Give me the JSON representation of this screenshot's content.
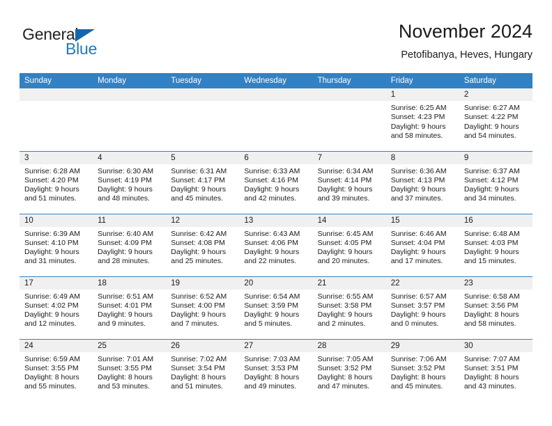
{
  "brand": {
    "name_part1": "General",
    "name_part2": "Blue",
    "triangle_color": "#1266b0",
    "blue_color": "#1f78c1"
  },
  "header": {
    "title": "November 2024",
    "subtitle": "Petofibanya, Heves, Hungary"
  },
  "theme": {
    "header_bg": "#3281c4",
    "daynum_bg": "#f0f0f0",
    "rule_color": "#3281c4"
  },
  "weekday_headers": [
    "Sunday",
    "Monday",
    "Tuesday",
    "Wednesday",
    "Thursday",
    "Friday",
    "Saturday"
  ],
  "weeks": [
    [
      {
        "day": "",
        "sunrise": "",
        "sunset": "",
        "daylight1": "",
        "daylight2": ""
      },
      {
        "day": "",
        "sunrise": "",
        "sunset": "",
        "daylight1": "",
        "daylight2": ""
      },
      {
        "day": "",
        "sunrise": "",
        "sunset": "",
        "daylight1": "",
        "daylight2": ""
      },
      {
        "day": "",
        "sunrise": "",
        "sunset": "",
        "daylight1": "",
        "daylight2": ""
      },
      {
        "day": "",
        "sunrise": "",
        "sunset": "",
        "daylight1": "",
        "daylight2": ""
      },
      {
        "day": "1",
        "sunrise": "Sunrise: 6:25 AM",
        "sunset": "Sunset: 4:23 PM",
        "daylight1": "Daylight: 9 hours",
        "daylight2": "and 58 minutes."
      },
      {
        "day": "2",
        "sunrise": "Sunrise: 6:27 AM",
        "sunset": "Sunset: 4:22 PM",
        "daylight1": "Daylight: 9 hours",
        "daylight2": "and 54 minutes."
      }
    ],
    [
      {
        "day": "3",
        "sunrise": "Sunrise: 6:28 AM",
        "sunset": "Sunset: 4:20 PM",
        "daylight1": "Daylight: 9 hours",
        "daylight2": "and 51 minutes."
      },
      {
        "day": "4",
        "sunrise": "Sunrise: 6:30 AM",
        "sunset": "Sunset: 4:19 PM",
        "daylight1": "Daylight: 9 hours",
        "daylight2": "and 48 minutes."
      },
      {
        "day": "5",
        "sunrise": "Sunrise: 6:31 AM",
        "sunset": "Sunset: 4:17 PM",
        "daylight1": "Daylight: 9 hours",
        "daylight2": "and 45 minutes."
      },
      {
        "day": "6",
        "sunrise": "Sunrise: 6:33 AM",
        "sunset": "Sunset: 4:16 PM",
        "daylight1": "Daylight: 9 hours",
        "daylight2": "and 42 minutes."
      },
      {
        "day": "7",
        "sunrise": "Sunrise: 6:34 AM",
        "sunset": "Sunset: 4:14 PM",
        "daylight1": "Daylight: 9 hours",
        "daylight2": "and 39 minutes."
      },
      {
        "day": "8",
        "sunrise": "Sunrise: 6:36 AM",
        "sunset": "Sunset: 4:13 PM",
        "daylight1": "Daylight: 9 hours",
        "daylight2": "and 37 minutes."
      },
      {
        "day": "9",
        "sunrise": "Sunrise: 6:37 AM",
        "sunset": "Sunset: 4:12 PM",
        "daylight1": "Daylight: 9 hours",
        "daylight2": "and 34 minutes."
      }
    ],
    [
      {
        "day": "10",
        "sunrise": "Sunrise: 6:39 AM",
        "sunset": "Sunset: 4:10 PM",
        "daylight1": "Daylight: 9 hours",
        "daylight2": "and 31 minutes."
      },
      {
        "day": "11",
        "sunrise": "Sunrise: 6:40 AM",
        "sunset": "Sunset: 4:09 PM",
        "daylight1": "Daylight: 9 hours",
        "daylight2": "and 28 minutes."
      },
      {
        "day": "12",
        "sunrise": "Sunrise: 6:42 AM",
        "sunset": "Sunset: 4:08 PM",
        "daylight1": "Daylight: 9 hours",
        "daylight2": "and 25 minutes."
      },
      {
        "day": "13",
        "sunrise": "Sunrise: 6:43 AM",
        "sunset": "Sunset: 4:06 PM",
        "daylight1": "Daylight: 9 hours",
        "daylight2": "and 22 minutes."
      },
      {
        "day": "14",
        "sunrise": "Sunrise: 6:45 AM",
        "sunset": "Sunset: 4:05 PM",
        "daylight1": "Daylight: 9 hours",
        "daylight2": "and 20 minutes."
      },
      {
        "day": "15",
        "sunrise": "Sunrise: 6:46 AM",
        "sunset": "Sunset: 4:04 PM",
        "daylight1": "Daylight: 9 hours",
        "daylight2": "and 17 minutes."
      },
      {
        "day": "16",
        "sunrise": "Sunrise: 6:48 AM",
        "sunset": "Sunset: 4:03 PM",
        "daylight1": "Daylight: 9 hours",
        "daylight2": "and 15 minutes."
      }
    ],
    [
      {
        "day": "17",
        "sunrise": "Sunrise: 6:49 AM",
        "sunset": "Sunset: 4:02 PM",
        "daylight1": "Daylight: 9 hours",
        "daylight2": "and 12 minutes."
      },
      {
        "day": "18",
        "sunrise": "Sunrise: 6:51 AM",
        "sunset": "Sunset: 4:01 PM",
        "daylight1": "Daylight: 9 hours",
        "daylight2": "and 9 minutes."
      },
      {
        "day": "19",
        "sunrise": "Sunrise: 6:52 AM",
        "sunset": "Sunset: 4:00 PM",
        "daylight1": "Daylight: 9 hours",
        "daylight2": "and 7 minutes."
      },
      {
        "day": "20",
        "sunrise": "Sunrise: 6:54 AM",
        "sunset": "Sunset: 3:59 PM",
        "daylight1": "Daylight: 9 hours",
        "daylight2": "and 5 minutes."
      },
      {
        "day": "21",
        "sunrise": "Sunrise: 6:55 AM",
        "sunset": "Sunset: 3:58 PM",
        "daylight1": "Daylight: 9 hours",
        "daylight2": "and 2 minutes."
      },
      {
        "day": "22",
        "sunrise": "Sunrise: 6:57 AM",
        "sunset": "Sunset: 3:57 PM",
        "daylight1": "Daylight: 9 hours",
        "daylight2": "and 0 minutes."
      },
      {
        "day": "23",
        "sunrise": "Sunrise: 6:58 AM",
        "sunset": "Sunset: 3:56 PM",
        "daylight1": "Daylight: 8 hours",
        "daylight2": "and 58 minutes."
      }
    ],
    [
      {
        "day": "24",
        "sunrise": "Sunrise: 6:59 AM",
        "sunset": "Sunset: 3:55 PM",
        "daylight1": "Daylight: 8 hours",
        "daylight2": "and 55 minutes."
      },
      {
        "day": "25",
        "sunrise": "Sunrise: 7:01 AM",
        "sunset": "Sunset: 3:55 PM",
        "daylight1": "Daylight: 8 hours",
        "daylight2": "and 53 minutes."
      },
      {
        "day": "26",
        "sunrise": "Sunrise: 7:02 AM",
        "sunset": "Sunset: 3:54 PM",
        "daylight1": "Daylight: 8 hours",
        "daylight2": "and 51 minutes."
      },
      {
        "day": "27",
        "sunrise": "Sunrise: 7:03 AM",
        "sunset": "Sunset: 3:53 PM",
        "daylight1": "Daylight: 8 hours",
        "daylight2": "and 49 minutes."
      },
      {
        "day": "28",
        "sunrise": "Sunrise: 7:05 AM",
        "sunset": "Sunset: 3:52 PM",
        "daylight1": "Daylight: 8 hours",
        "daylight2": "and 47 minutes."
      },
      {
        "day": "29",
        "sunrise": "Sunrise: 7:06 AM",
        "sunset": "Sunset: 3:52 PM",
        "daylight1": "Daylight: 8 hours",
        "daylight2": "and 45 minutes."
      },
      {
        "day": "30",
        "sunrise": "Sunrise: 7:07 AM",
        "sunset": "Sunset: 3:51 PM",
        "daylight1": "Daylight: 8 hours",
        "daylight2": "and 43 minutes."
      }
    ]
  ]
}
